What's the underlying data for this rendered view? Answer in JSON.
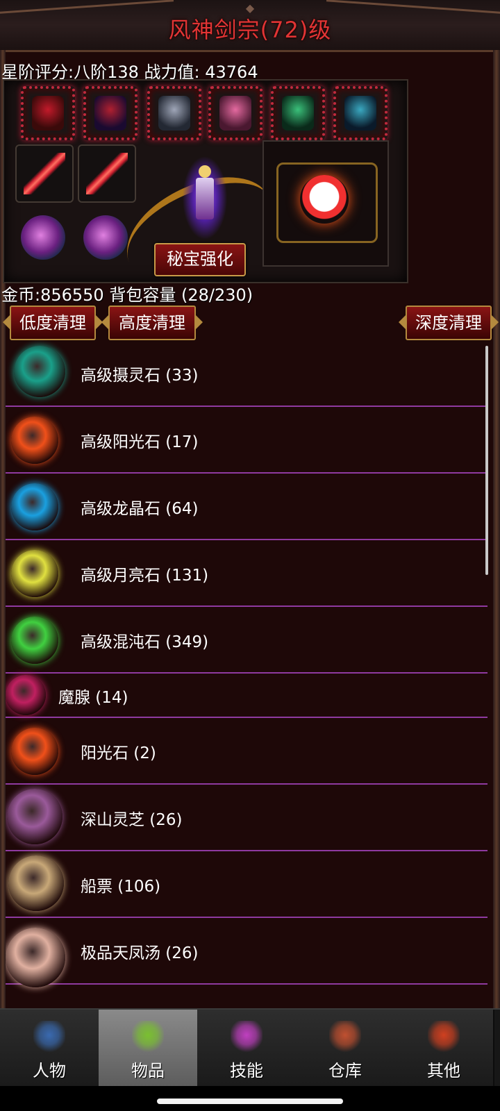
{
  "header": {
    "title": "风神剑宗(72)级"
  },
  "stats": {
    "rating_text": "星阶评分:八阶138 战力值: 43764"
  },
  "equipment": {
    "treasure_button": "秘宝强化"
  },
  "inventory_info": {
    "text": "金币:856550 背包容量 (28/230)"
  },
  "clean_buttons": {
    "low": "低度清理",
    "high": "高度清理",
    "deep": "深度清理"
  },
  "items": [
    {
      "label": "高级摄灵石 (33)",
      "icon": "green-egg-stone-icon",
      "color": "#1aa08a"
    },
    {
      "label": "高级阳光石 (17)",
      "icon": "sun-stone-icon",
      "color": "#f0501a"
    },
    {
      "label": "高级龙晶石 (64)",
      "icon": "dragon-crystal-icon",
      "color": "#1aa0e0"
    },
    {
      "label": "高级月亮石 (131)",
      "icon": "moon-stone-icon",
      "color": "#e0e040"
    },
    {
      "label": "高级混沌石 (349)",
      "icon": "chaos-stone-icon",
      "color": "#40d040"
    },
    {
      "label": "魔腺 (14)",
      "icon": "demon-gland-icon",
      "color": "#c02060"
    },
    {
      "label": "阳光石 (2)",
      "icon": "sun-stone-icon",
      "color": "#f0501a"
    },
    {
      "label": "深山灵芝 (26)",
      "icon": "lingzhi-mushroom-icon",
      "color": "#9a5a9a"
    },
    {
      "label": "船票 (106)",
      "icon": "scroll-ticket-icon",
      "color": "#c8a878"
    },
    {
      "label": "极品天凤汤 (26)",
      "icon": "soup-bowl-icon",
      "color": "#e0b0a0"
    }
  ],
  "nav": {
    "tabs": [
      {
        "label": "人物",
        "icon": "character-icon",
        "color": "#3a6ab0"
      },
      {
        "label": "物品",
        "icon": "potion-icon",
        "color": "#7ac030"
      },
      {
        "label": "技能",
        "icon": "skill-orb-icon",
        "color": "#c040c0"
      },
      {
        "label": "仓库",
        "icon": "warehouse-icon",
        "color": "#c05030"
      },
      {
        "label": "其他",
        "icon": "other-icon",
        "color": "#d04020"
      }
    ],
    "active_index": 1
  }
}
